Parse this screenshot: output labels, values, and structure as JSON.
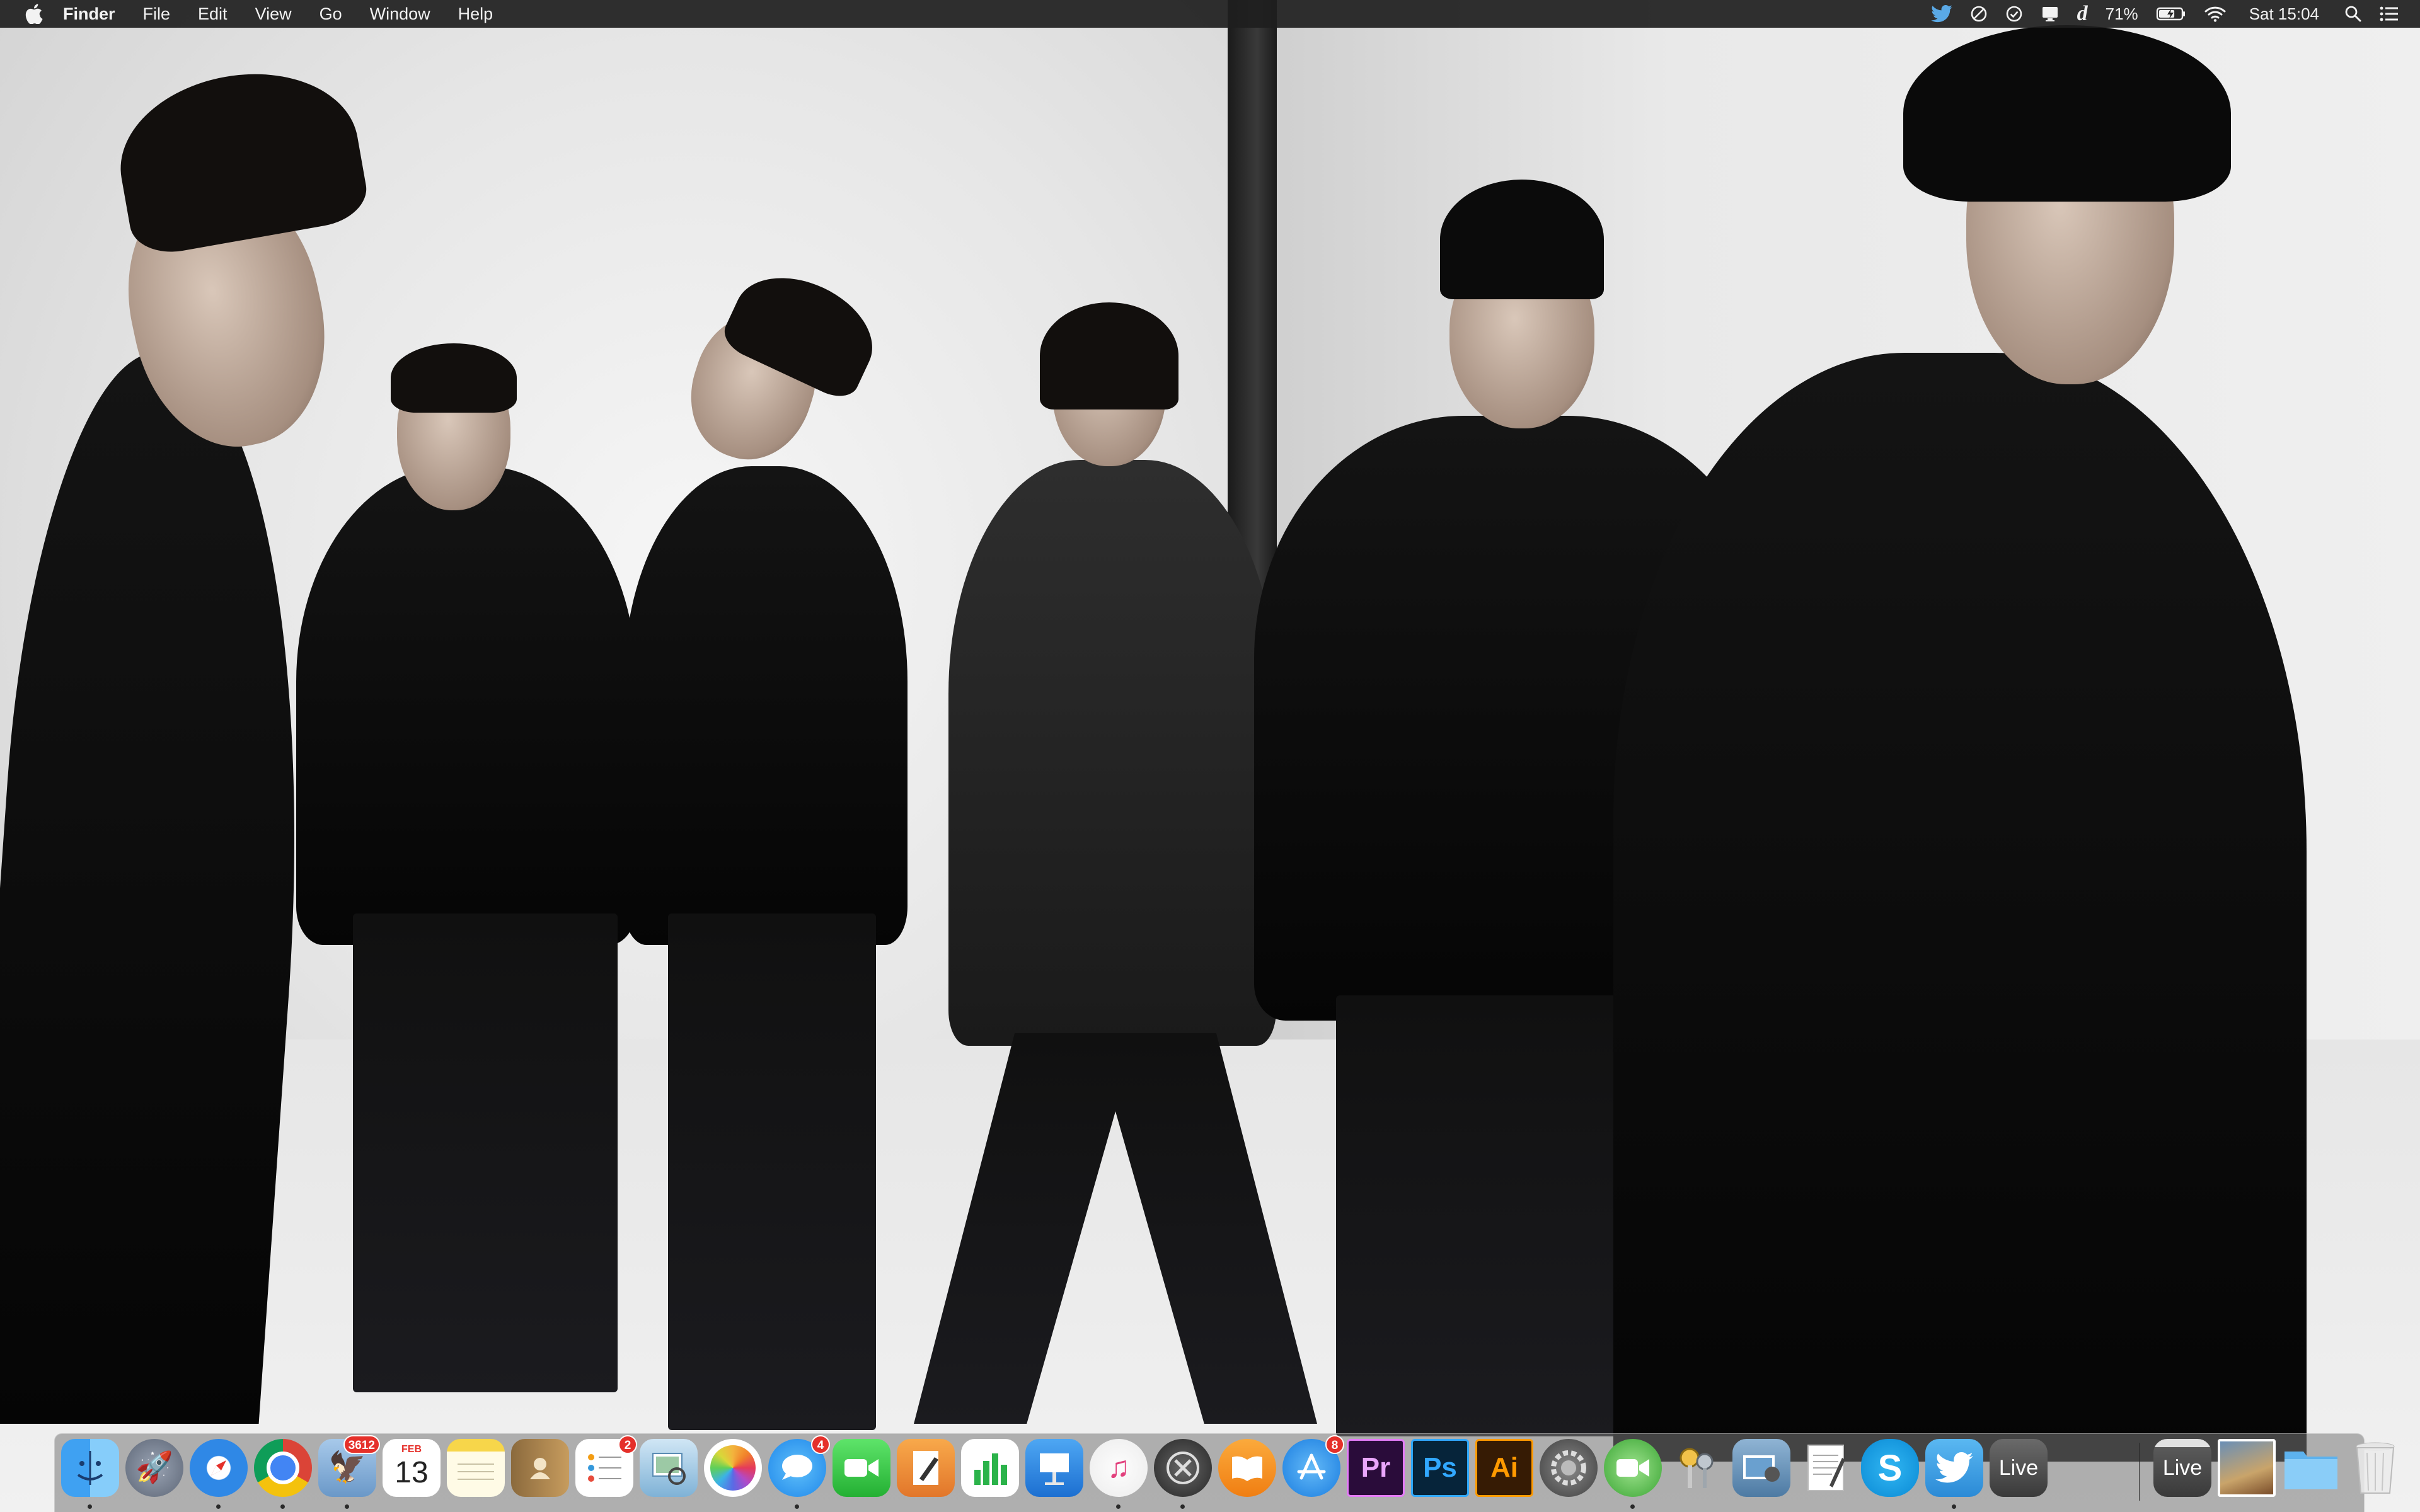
{
  "menubar": {
    "app_name": "Finder",
    "menus": [
      "File",
      "Edit",
      "View",
      "Go",
      "Window",
      "Help"
    ],
    "battery_percent": "71%",
    "clock": "Sat 15:04",
    "status_icons": [
      "twitter-icon",
      "block-icon",
      "checkmark-icon",
      "display-icon",
      "dictionary-icon",
      "battery-icon",
      "wifi-icon",
      "search-icon",
      "notification-center-icon"
    ]
  },
  "dock": {
    "items": [
      {
        "name": "finder",
        "label": "",
        "badge": "",
        "running": true
      },
      {
        "name": "launchpad",
        "label": "",
        "badge": "",
        "running": false
      },
      {
        "name": "safari",
        "label": "",
        "badge": "",
        "running": true
      },
      {
        "name": "chrome",
        "label": "",
        "badge": "",
        "running": true
      },
      {
        "name": "mail",
        "label": "",
        "badge": "3612",
        "running": true
      },
      {
        "name": "calendar",
        "label": "13",
        "month": "FEB",
        "badge": "",
        "running": false
      },
      {
        "name": "notes",
        "label": "",
        "badge": "",
        "running": false
      },
      {
        "name": "contacts",
        "label": "",
        "badge": "",
        "running": false
      },
      {
        "name": "reminders",
        "label": "",
        "badge": "2",
        "running": false
      },
      {
        "name": "preview",
        "label": "",
        "badge": "",
        "running": false
      },
      {
        "name": "photos",
        "label": "",
        "badge": "",
        "running": false
      },
      {
        "name": "messages",
        "label": "",
        "badge": "4",
        "running": true
      },
      {
        "name": "facetime",
        "label": "",
        "badge": "",
        "running": false
      },
      {
        "name": "pages",
        "label": "",
        "badge": "",
        "running": false
      },
      {
        "name": "numbers",
        "label": "",
        "badge": "",
        "running": false
      },
      {
        "name": "keynote",
        "label": "",
        "badge": "",
        "running": false
      },
      {
        "name": "itunes",
        "label": "",
        "badge": "",
        "running": true
      },
      {
        "name": "traktor",
        "label": "",
        "badge": "",
        "running": true
      },
      {
        "name": "ibooks",
        "label": "",
        "badge": "",
        "running": false
      },
      {
        "name": "app-store",
        "label": "",
        "badge": "8",
        "running": false
      },
      {
        "name": "premiere",
        "label": "Pr",
        "badge": "",
        "running": false
      },
      {
        "name": "photoshop",
        "label": "Ps",
        "badge": "",
        "running": false
      },
      {
        "name": "illustrator",
        "label": "Ai",
        "badge": "",
        "running": false
      },
      {
        "name": "system-preferences",
        "label": "",
        "badge": "",
        "running": false
      },
      {
        "name": "facetime-alt",
        "label": "",
        "badge": "",
        "running": true
      },
      {
        "name": "keychain",
        "label": "",
        "badge": "",
        "running": false
      },
      {
        "name": "image-capture",
        "label": "",
        "badge": "",
        "running": false
      },
      {
        "name": "textedit",
        "label": "",
        "badge": "",
        "running": false
      },
      {
        "name": "skype",
        "label": "S",
        "badge": "",
        "running": false
      },
      {
        "name": "twitter",
        "label": "",
        "badge": "",
        "running": true
      },
      {
        "name": "ableton-live",
        "label": "Live",
        "badge": "",
        "running": false
      }
    ],
    "stack_items": [
      {
        "name": "ableton-live-folder",
        "label": "Live"
      },
      {
        "name": "photo-stack",
        "label": ""
      },
      {
        "name": "applications-folder",
        "label": ""
      },
      {
        "name": "trash",
        "label": ""
      }
    ]
  },
  "colors": {
    "menubar_bg": "#1e1e1e",
    "badge_red": "#e5302a"
  }
}
